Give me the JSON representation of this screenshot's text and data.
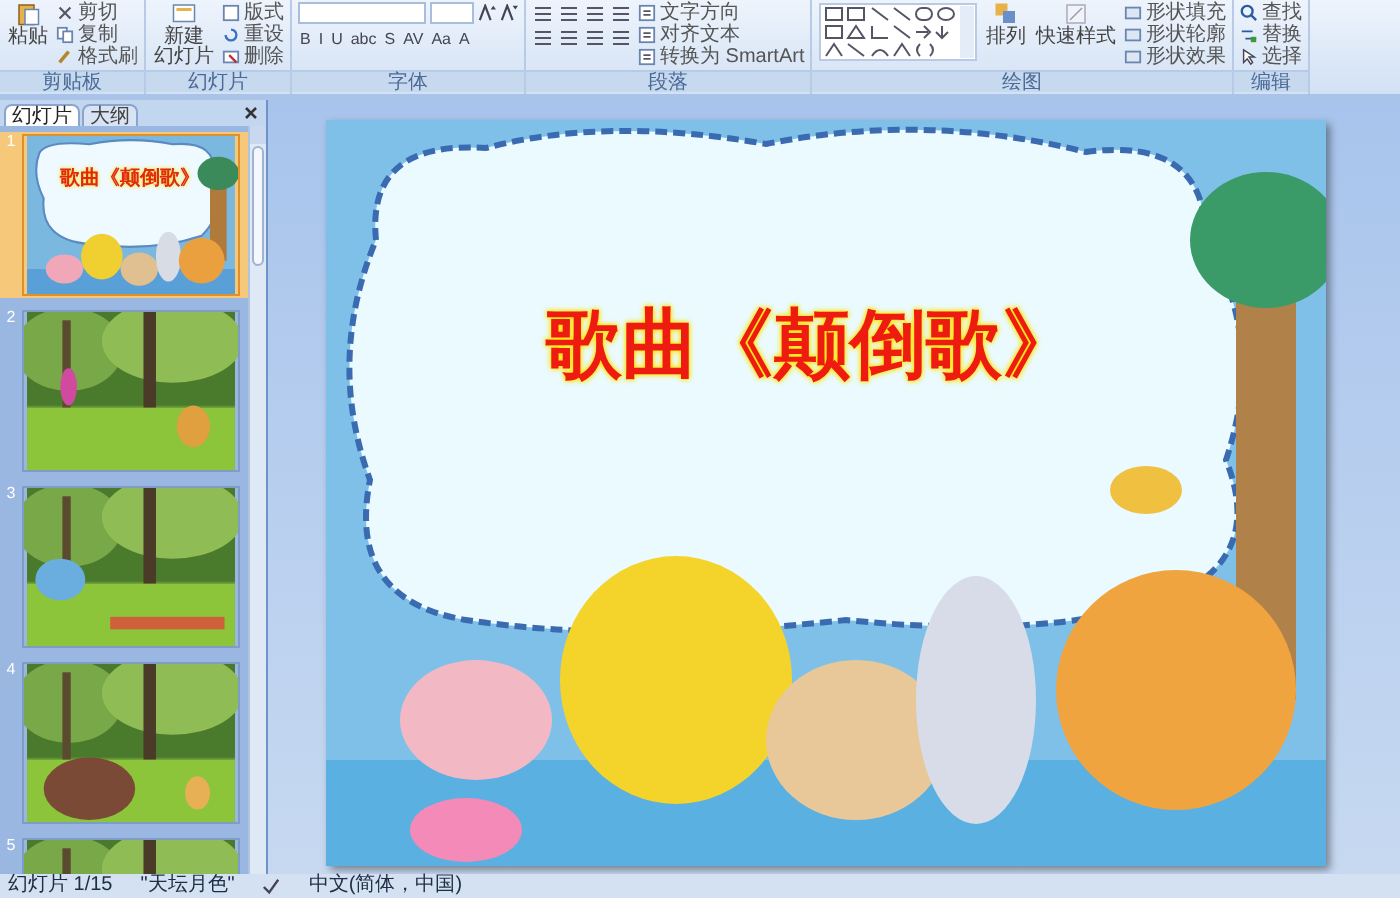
{
  "ribbon": {
    "groups": [
      {
        "kind": "clipboard",
        "label": "剪贴板",
        "big": [
          "粘贴"
        ],
        "small": [
          "剪切",
          "复制",
          "格式刷"
        ]
      },
      {
        "kind": "slides",
        "label": "幻灯片",
        "big": [
          "新建",
          "幻灯片"
        ],
        "small": [
          "版式",
          "重设",
          "删除"
        ]
      },
      {
        "kind": "font",
        "label": "字体",
        "buttons": [
          "B",
          "I",
          "U",
          "abc",
          "S",
          "AV",
          "Aa",
          "A"
        ]
      },
      {
        "kind": "paragraph",
        "label": "段落",
        "small": [
          "文字方向",
          "对齐文本",
          "转换为 SmartArt"
        ]
      },
      {
        "kind": "drawing",
        "label": "绘图",
        "big": [
          "排列"
        ],
        "quick": "快速样式",
        "small": [
          "形状填充",
          "形状轮廓",
          "形状效果"
        ]
      },
      {
        "kind": "editing",
        "label": "编辑",
        "small": [
          "查找",
          "替换",
          "选择"
        ]
      }
    ]
  },
  "panel": {
    "tabs": [
      {
        "label": "幻灯片",
        "selected": true
      },
      {
        "label": "大纲",
        "selected": false
      }
    ],
    "thumbnails": [
      {
        "number": "1",
        "selected": true,
        "kind": "title",
        "title": "歌曲《颠倒歌》"
      },
      {
        "number": "2",
        "selected": false,
        "kind": "forest"
      },
      {
        "number": "3",
        "selected": false,
        "kind": "forest"
      },
      {
        "number": "4",
        "selected": false,
        "kind": "forest"
      },
      {
        "number": "5",
        "selected": false,
        "kind": "forest"
      }
    ]
  },
  "slide": {
    "title": "歌曲《颠倒歌》"
  },
  "status_bar": {
    "slide": "幻灯片 1/15",
    "theme": "\"天坛月色\"",
    "language": "中文(简体，中国)"
  }
}
